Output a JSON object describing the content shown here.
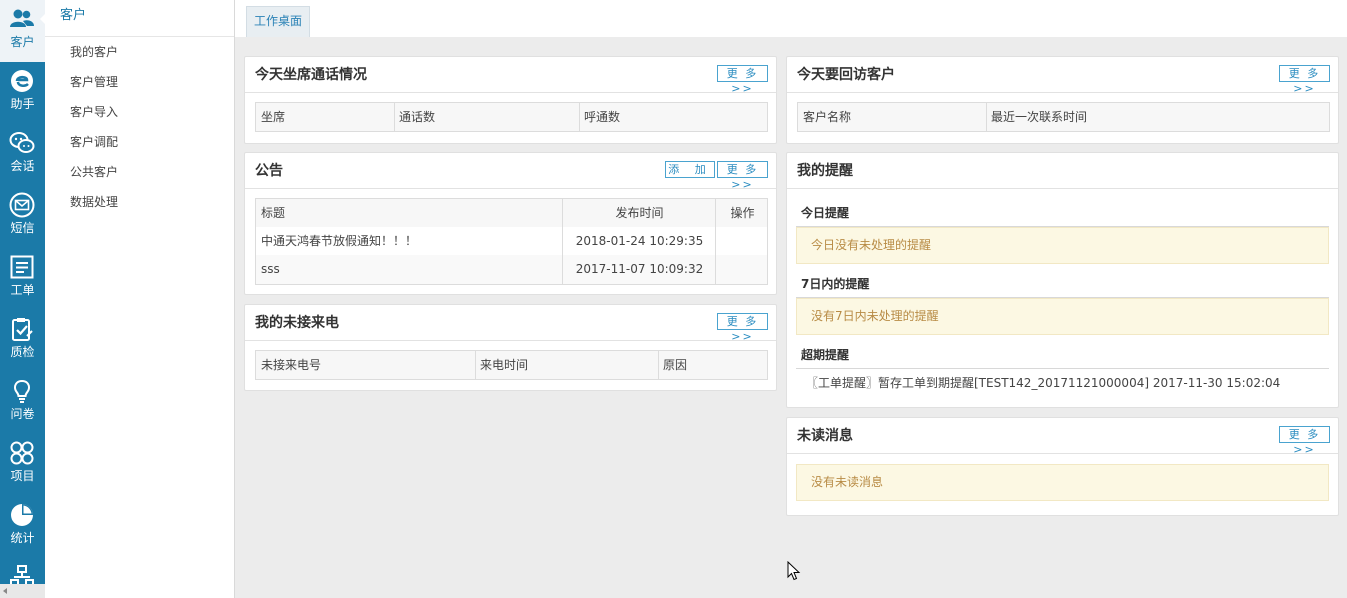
{
  "rail": {
    "items": [
      {
        "label": "客户",
        "icon": "users-icon"
      },
      {
        "label": "助手",
        "icon": "assistant-icon"
      },
      {
        "label": "会话",
        "icon": "wechat-icon"
      },
      {
        "label": "短信",
        "icon": "mail-icon"
      },
      {
        "label": "工单",
        "icon": "ticket-icon"
      },
      {
        "label": "质检",
        "icon": "clipboard-check-icon"
      },
      {
        "label": "问卷",
        "icon": "lightbulb-icon"
      },
      {
        "label": "项目",
        "icon": "grid-icon"
      },
      {
        "label": "统计",
        "icon": "pie-chart-icon"
      }
    ],
    "accent": "#1b7aa8"
  },
  "submenu": {
    "title": "客户",
    "items": [
      "我的客户",
      "客户管理",
      "客户导入",
      "客户调配",
      "公共客户",
      "数据处理"
    ]
  },
  "tabs": {
    "active": "工作桌面"
  },
  "labels": {
    "more": "更 多 >>",
    "add": "添 加"
  },
  "calls": {
    "title": "今天坐席通话情况",
    "columns": [
      "坐席",
      "通话数",
      "呼通数"
    ]
  },
  "announcements": {
    "title": "公告",
    "columns": [
      "标题",
      "发布时间",
      "操作"
    ],
    "rows": [
      {
        "title": "中通天鸿春节放假通知！！！",
        "time": "2018-01-24 10:29:35",
        "action": ""
      },
      {
        "title": "sss",
        "time": "2017-11-07 10:09:32",
        "action": ""
      }
    ]
  },
  "missed": {
    "title": "我的未接来电",
    "columns": [
      "未接来电号",
      "来电时间",
      "原因"
    ]
  },
  "revisit": {
    "title": "今天要回访客户",
    "columns": [
      "客户名称",
      "最近一次联系时间"
    ]
  },
  "reminders": {
    "title": "我的提醒",
    "today_head": "今日提醒",
    "today_msg": "今日没有未处理的提醒",
    "week_head": "7日内的提醒",
    "week_msg": "没有7日内未处理的提醒",
    "overdue_head": "超期提醒",
    "overdue_item": "〖工单提醒〗暂存工单到期提醒[TEST142_20171121000004]  2017-11-30 15:02:04"
  },
  "unread": {
    "title": "未读消息",
    "msg": "没有未读消息"
  }
}
